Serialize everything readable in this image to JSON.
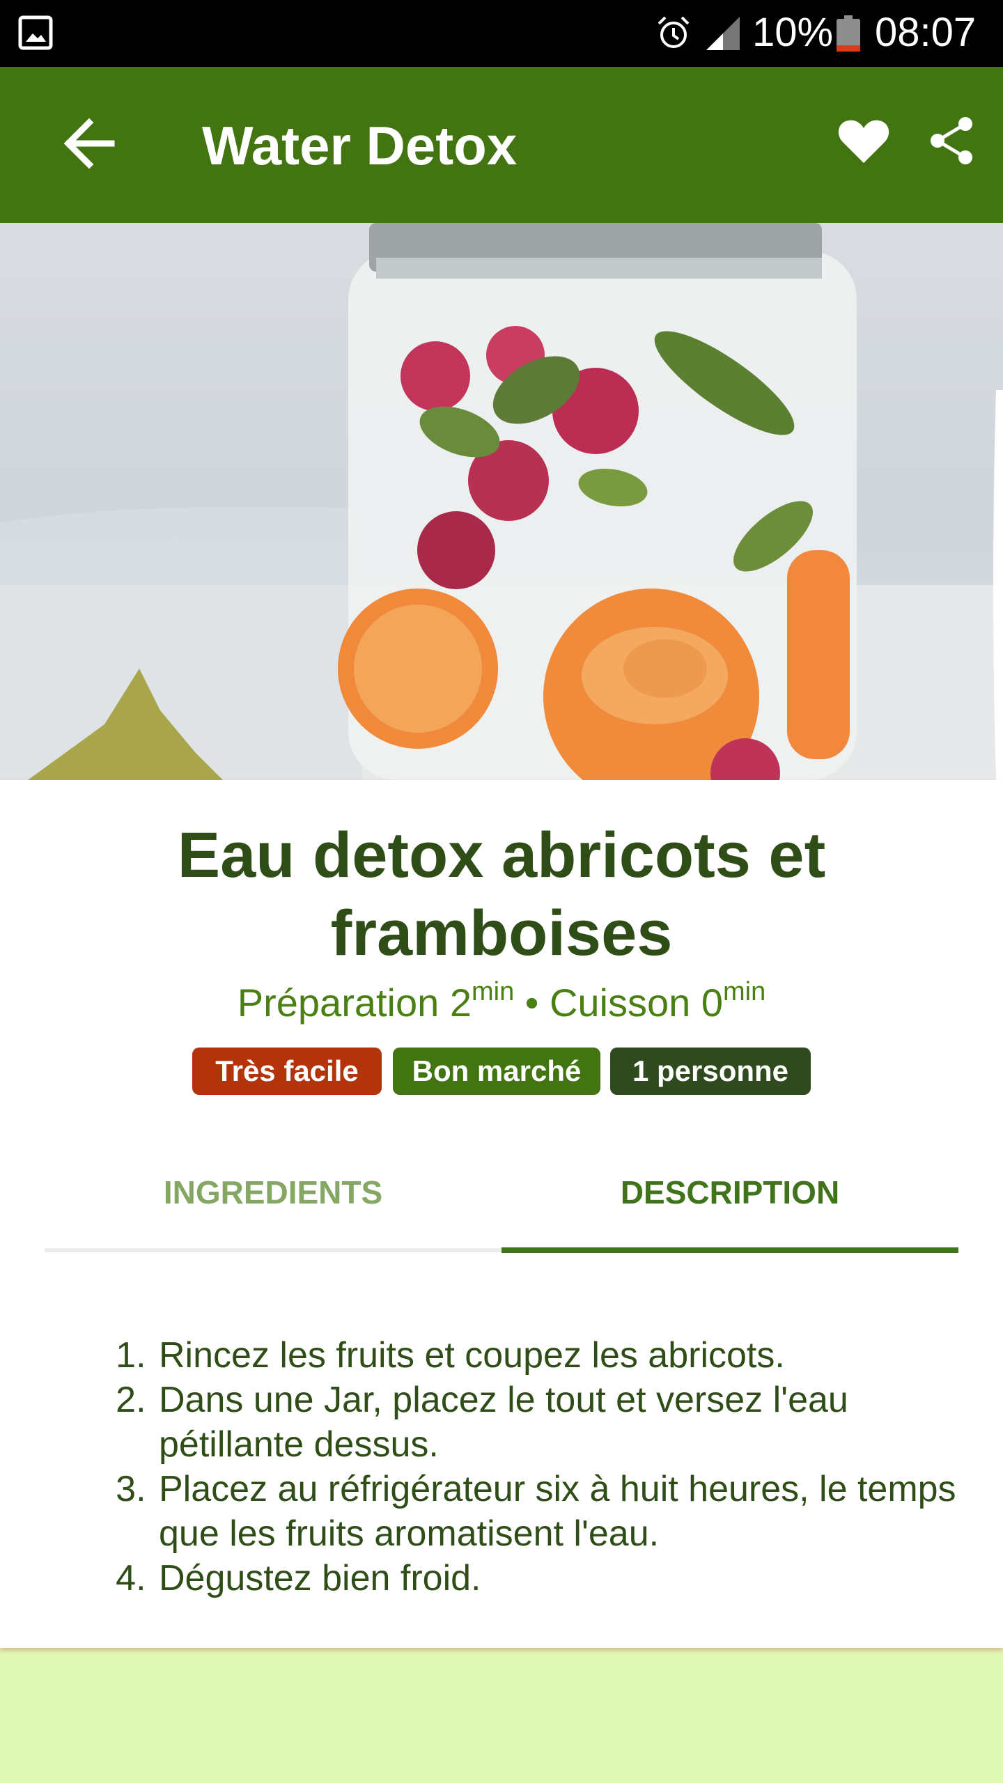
{
  "status_bar": {
    "battery_percent": "10%",
    "time": "08:07",
    "icons": [
      "gallery-icon",
      "alarm-icon",
      "signal-icon",
      "battery-icon"
    ]
  },
  "app_bar": {
    "title": "Water Detox",
    "icons": [
      "back-arrow-icon",
      "heart-icon",
      "share-icon"
    ]
  },
  "recipe": {
    "title": "Eau detox abricots et framboises",
    "prep_label": "Préparation 2",
    "prep_unit": "min",
    "separator": " • ",
    "cook_label": "Cuisson 0",
    "cook_unit": "min",
    "tags": {
      "difficulty": "Très facile",
      "cost": "Bon marché",
      "servings": "1 personne"
    }
  },
  "tabs": {
    "ingredients": "INGREDIENTS",
    "description": "DESCRIPTION",
    "selected": "DESCRIPTION"
  },
  "steps": [
    "Rincez les fruits et coupez les abricots.",
    "Dans une Jar, placez le tout et versez l'eau pétillante dessus.",
    "Placez au réfrigérateur six à huit heures, le temps que les fruits aromatisent l'eau.",
    "Dégustez bien froid."
  ],
  "colors": {
    "app_bar": "#427411",
    "title_text": "#2f4d17",
    "tag_difficulty": "#b3330a",
    "tag_cost": "#427411",
    "tag_servings": "#2f4a1c",
    "page_background": "#dff8b3"
  }
}
